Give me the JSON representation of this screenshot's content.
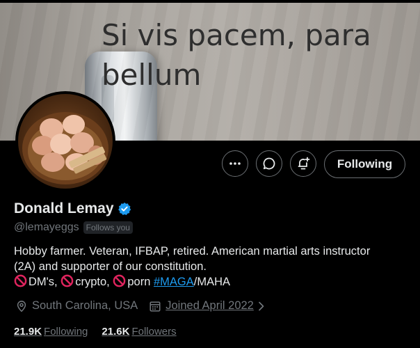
{
  "banner": {
    "motto": "Si vis pacem, para bellum"
  },
  "profile": {
    "display_name": "Donald Lemay",
    "handle": "@lemayeggs",
    "follows_you": "Follows you",
    "bio_line1": "Hobby farmer. Veteran, IFBAP, retired. American martial arts instructor",
    "bio_line2": "(2A) and supporter of our constitution.",
    "bio_dms": "DM's,",
    "bio_crypto": "crypto,",
    "bio_porn": "porn",
    "bio_hashtag": "#MAGA",
    "bio_tail": "/MAHA",
    "location": "South Carolina, USA",
    "joined": "Joined April 2022",
    "following_count": "21.9K",
    "following_label": "Following",
    "followers_count": "21.6K",
    "followers_label": "Followers"
  },
  "actions": {
    "follow_label": "Following"
  },
  "icons": {
    "more": "more-icon",
    "message": "message-icon",
    "notify": "notify-bell-icon",
    "verified": "verified-badge-icon",
    "location": "location-icon",
    "calendar": "calendar-icon",
    "ban": "prohibited-icon"
  },
  "colors": {
    "accent": "#1d9bf0",
    "ban_red": "#e0245e",
    "muted": "#71767b"
  }
}
